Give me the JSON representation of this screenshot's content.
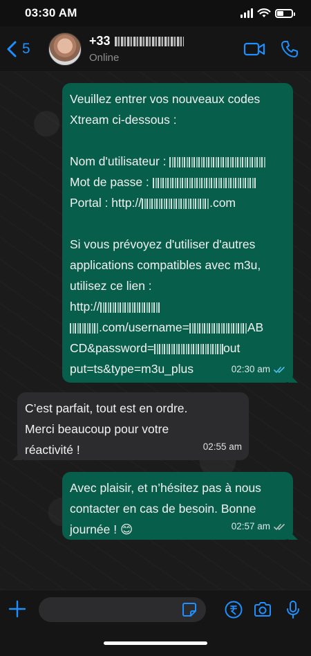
{
  "status_bar": {
    "time": "03:30 AM"
  },
  "header": {
    "back_count": "5",
    "contact_name_prefix": "+33",
    "contact_status": "Online"
  },
  "messages": [
    {
      "direction": "out",
      "lines": [
        "Veuillez entrer vos nouveaux codes",
        "Xtream ci-dessous :",
        "",
        "Nom d'utilisateur : ",
        "Mot de passe : ",
        "Portal : http://",
        ".com",
        "",
        "Si vous prévoyez d'utiliser d'autres",
        "applications compatibles avec m3u,",
        "utilisez ce lien :",
        "http://",
        ".com/username=",
        "AB",
        "CD&password=",
        "out",
        "put=ts&type=m3u_plus"
      ],
      "time": "02:30 am",
      "status": "read"
    },
    {
      "direction": "in",
      "lines": [
        "C’est parfait, tout est en ordre.",
        "Merci beaucoup pour votre",
        "réactivité !"
      ],
      "time": "02:55 am"
    },
    {
      "direction": "out",
      "lines": [
        "Avec plaisir, et n’hésitez pas à nous",
        "contacter en cas de besoin. Bonne",
        "journée ! 😊"
      ],
      "time": "02:57 am",
      "status": "delivered"
    }
  ],
  "input": {
    "placeholder": ""
  },
  "colors": {
    "accent": "#1e90ff",
    "outgoing_bubble": "#075e4a",
    "incoming_bubble": "#2c2c2e",
    "read_ticks": "#53bdeb"
  },
  "icons": [
    "chevron-left-icon",
    "video-camera-icon",
    "phone-icon",
    "plus-icon",
    "sticker-icon",
    "rupee-payment-icon",
    "camera-icon",
    "microphone-icon"
  ]
}
